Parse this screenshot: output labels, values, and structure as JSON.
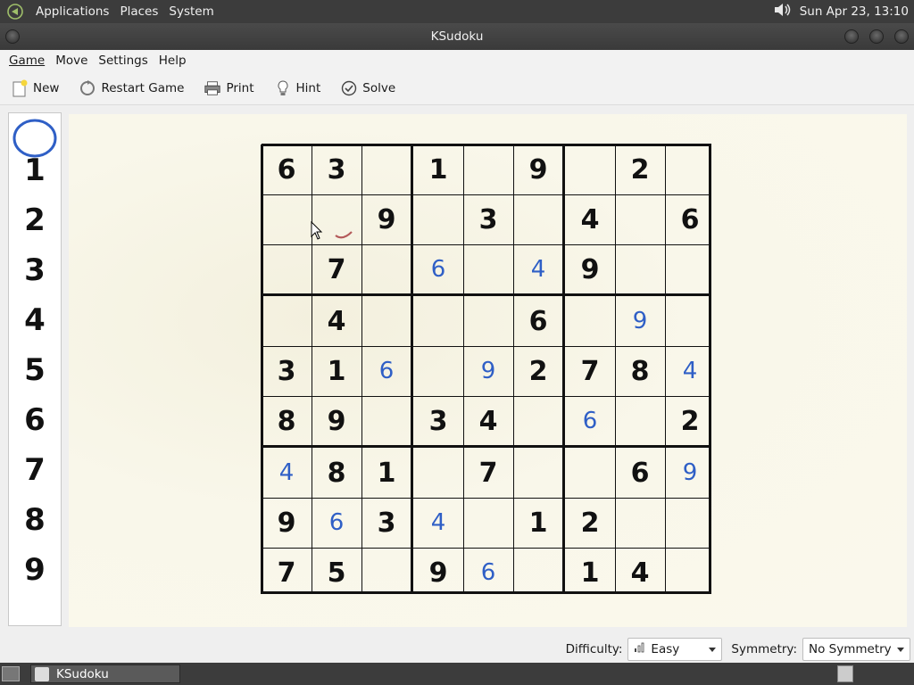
{
  "top_panel": {
    "menus": [
      "Applications",
      "Places",
      "System"
    ],
    "clock": "Sun Apr 23, 13:10",
    "icons": {
      "logo": "gnome-foot-icon",
      "volume": "speaker-icon"
    }
  },
  "window": {
    "title": "KSudoku"
  },
  "menubar": {
    "items": [
      {
        "label": "Game",
        "mnemonic": "G"
      },
      {
        "label": "Move",
        "mnemonic": "M"
      },
      {
        "label": "Settings",
        "mnemonic": "S"
      },
      {
        "label": "Help",
        "mnemonic": "H"
      }
    ]
  },
  "toolbar": {
    "new_label": "New",
    "restart_label": "Restart Game",
    "print_label": "Print",
    "hint_label": "Hint",
    "solve_label": "Solve"
  },
  "number_panel": {
    "numbers": [
      "1",
      "2",
      "3",
      "4",
      "5",
      "6",
      "7",
      "8",
      "9"
    ],
    "selected": "4"
  },
  "sudoku": {
    "rows": [
      [
        "6",
        "3",
        "",
        "1",
        "",
        "9",
        "",
        "2",
        ""
      ],
      [
        "",
        "",
        "9",
        "",
        "3",
        "",
        "4",
        "",
        "6"
      ],
      [
        "",
        "7",
        "",
        "6",
        "",
        "4",
        "9",
        "",
        ""
      ],
      [
        "",
        "4",
        "",
        "",
        "",
        "6",
        "",
        "9",
        ""
      ],
      [
        "3",
        "1",
        "6",
        "",
        "9",
        "2",
        "7",
        "8",
        "4"
      ],
      [
        "8",
        "9",
        "",
        "3",
        "4",
        "",
        "6",
        "",
        "2"
      ],
      [
        "4",
        "8",
        "1",
        "",
        "7",
        "",
        "",
        "6",
        "9"
      ],
      [
        "9",
        "6",
        "3",
        "4",
        "",
        "1",
        "2",
        "",
        ""
      ],
      [
        "7",
        "5",
        "",
        "9",
        "6",
        "",
        "1",
        "4",
        ""
      ]
    ],
    "user_entries": [
      [
        2,
        3
      ],
      [
        2,
        5
      ],
      [
        3,
        7
      ],
      [
        4,
        2
      ],
      [
        4,
        4
      ],
      [
        4,
        8
      ],
      [
        5,
        6
      ],
      [
        6,
        0
      ],
      [
        6,
        8
      ],
      [
        7,
        1
      ],
      [
        7,
        3
      ],
      [
        8,
        4
      ]
    ],
    "colors": {
      "given": "#111111",
      "user": "#2f5fc6",
      "highlight": "#2f5fc6"
    }
  },
  "status": {
    "difficulty_label": "Difficulty:",
    "difficulty_value": "Easy",
    "symmetry_label": "Symmetry:",
    "symmetry_value": "No Symmetry"
  },
  "taskbar": {
    "task_label": "KSudoku"
  }
}
